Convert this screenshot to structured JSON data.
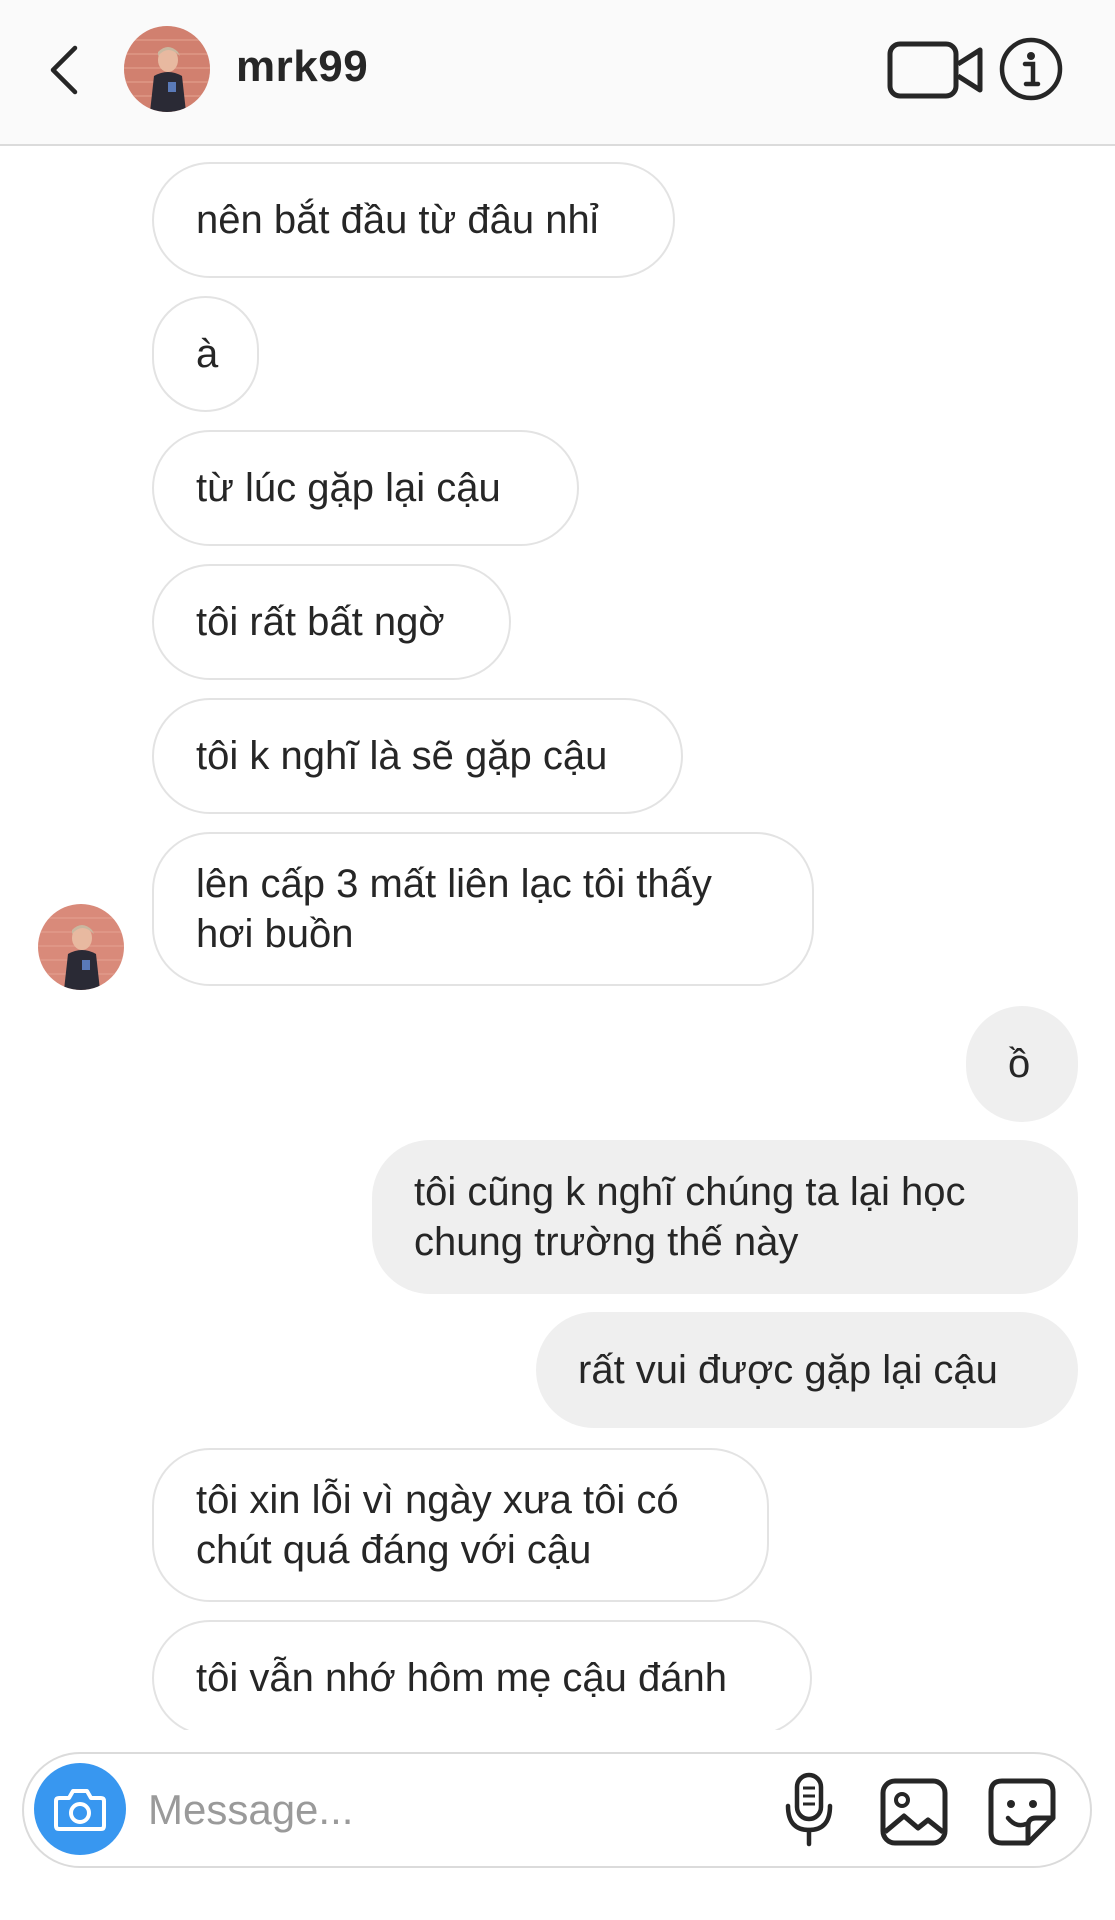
{
  "header": {
    "username": "mrk99",
    "back_icon": "chevron-left-icon",
    "video_icon": "video-camera-icon",
    "info_icon": "info-icon"
  },
  "messages": [
    {
      "direction": "incoming",
      "text": "nên bắt đầu từ đâu nhỉ"
    },
    {
      "direction": "incoming",
      "text": "à"
    },
    {
      "direction": "incoming",
      "text": "từ lúc gặp lại cậu"
    },
    {
      "direction": "incoming",
      "text": "tôi rất bất ngờ"
    },
    {
      "direction": "incoming",
      "text": "tôi k nghĩ là sẽ gặp cậu"
    },
    {
      "direction": "incoming",
      "text": "lên cấp 3 mất liên lạc tôi thấy\nhơi buồn",
      "show_avatar": true
    },
    {
      "direction": "outgoing",
      "text": "ồ"
    },
    {
      "direction": "outgoing",
      "text": "tôi cũng k nghĩ chúng ta lại học\nchung trường thế này"
    },
    {
      "direction": "outgoing",
      "text": "rất vui được gặp lại cậu"
    },
    {
      "direction": "incoming",
      "text": "tôi xin lỗi vì ngày xưa tôi có\nchút quá đáng với cậu"
    },
    {
      "direction": "incoming",
      "text": "tôi vẫn nhớ hôm mẹ cậu đánh"
    }
  ],
  "composer": {
    "placeholder": "Message...",
    "value": "",
    "camera_icon": "camera-icon",
    "mic_icon": "microphone-icon",
    "gallery_icon": "gallery-icon",
    "sticker_icon": "sticker-icon"
  },
  "colors": {
    "accent": "#3897f0",
    "incoming_border": "#e3e3e3",
    "outgoing_bg": "#efefef",
    "header_bg": "#fafafa"
  }
}
